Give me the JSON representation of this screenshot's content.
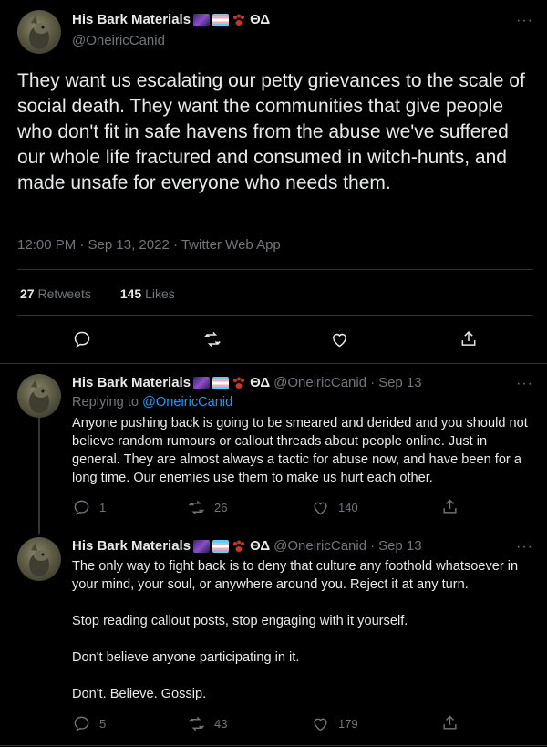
{
  "main_tweet": {
    "display_name": "His Bark Materials",
    "handle": "@OneiricCanid",
    "text": "They want us escalating our petty grievances to the scale of social death. They want the communities that give people who don't fit in safe havens from the abuse we've suffered our whole life fractured and consumed in witch-hunts, and made unsafe for everyone who needs them.",
    "timestamp": "12:00 PM · Sep 13, 2022 · Twitter Web App",
    "retweets_count": "27",
    "retweets_label": "Retweets",
    "likes_count": "145",
    "likes_label": "Likes"
  },
  "reply1": {
    "display_name": "His Bark Materials",
    "handle": "@OneiricCanid",
    "date": "Sep 13",
    "replying_prefix": "Replying to ",
    "replying_to": "@OneiricCanid",
    "text": "Anyone pushing back is going to be smeared and derided and you should not believe random rumours or callout threads about people online. Just in general. They are almost always a tactic for abuse now, and have been for a long time. Our enemies use them to make us hurt each other.",
    "replies": "1",
    "retweets": "26",
    "likes": "140"
  },
  "reply2": {
    "display_name": "His Bark Materials",
    "handle": "@OneiricCanid",
    "date": "Sep 13",
    "paragraphs": [
      "The only way to fight back is to deny that culture any foothold whatsoever in your mind, your soul, or anywhere around you. Reject it at any turn.",
      "Stop reading callout posts, stop engaging with it yourself.",
      "Don't believe anyone participating in it.",
      "Don't. Believe. Gossip."
    ],
    "replies": "5",
    "retweets": "43",
    "likes": "179"
  },
  "name_suffix": "ΘΔ",
  "separator": "·",
  "more_label": "···",
  "colors": {
    "background": "#000000",
    "text": "#e7e9ea",
    "muted": "#71767b",
    "link": "#1d9bf0",
    "divider": "#2f3336"
  }
}
